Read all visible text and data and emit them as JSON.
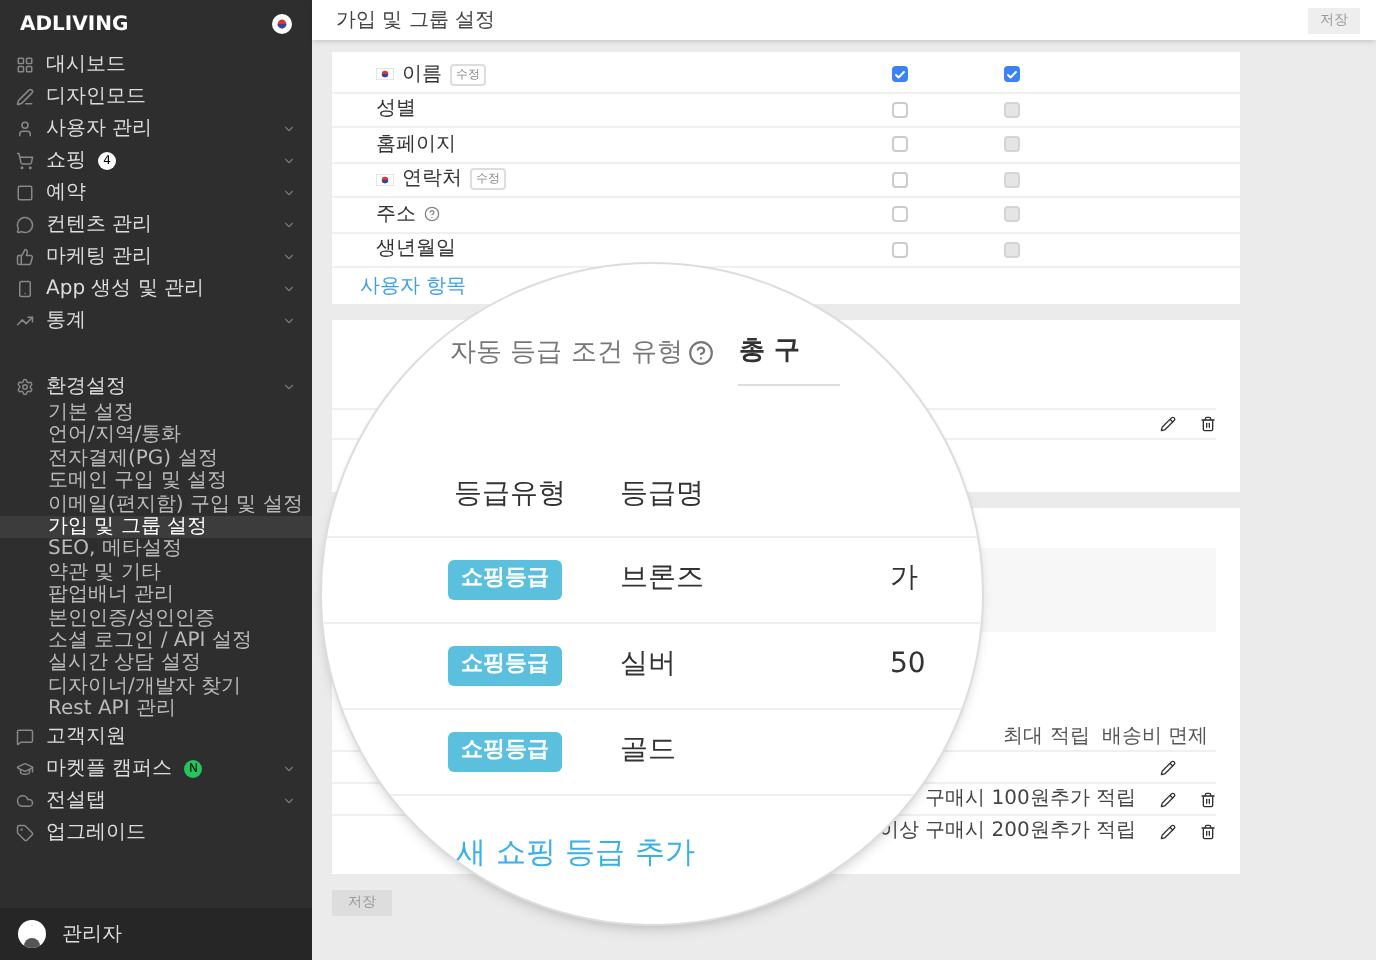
{
  "sidebar": {
    "brand": "ADLIVING",
    "items": [
      {
        "label": "대시보드",
        "expandable": false
      },
      {
        "label": "디자인모드",
        "expandable": false
      },
      {
        "label": "사용자 관리",
        "expandable": true
      },
      {
        "label": "쇼핑",
        "expandable": true,
        "badge": {
          "text": "4",
          "color": "#ffffff"
        }
      },
      {
        "label": "예약",
        "expandable": true
      },
      {
        "label": "컨텐츠 관리",
        "expandable": true
      },
      {
        "label": "마케팅 관리",
        "expandable": true
      },
      {
        "label": "App 생성 및 관리",
        "expandable": true
      },
      {
        "label": "통계",
        "expandable": true
      },
      {
        "label": "환경설정",
        "expandable": true,
        "children": [
          {
            "label": "기본 설정",
            "selected": false
          },
          {
            "label": "언어/지역/통화",
            "selected": false
          },
          {
            "label": "전자결제(PG) 설정",
            "selected": false
          },
          {
            "label": "도메인 구입 및 설정",
            "selected": false
          },
          {
            "label": "이메일(편지함) 구입 및 설정",
            "selected": false
          },
          {
            "label": "가입 및 그룹 설정",
            "selected": true
          },
          {
            "label": "SEO, 메타설정",
            "selected": false
          },
          {
            "label": "약관 및 기타",
            "selected": false
          },
          {
            "label": "팝업배너 관리",
            "selected": false
          },
          {
            "label": "본인인증/성인인증",
            "selected": false
          },
          {
            "label": "소셜 로그인 / API 설정",
            "selected": false
          },
          {
            "label": "실시간 상담 설정",
            "selected": false
          },
          {
            "label": "디자이너/개발자 찾기",
            "selected": false
          },
          {
            "label": "Rest API 관리",
            "selected": false
          }
        ]
      },
      {
        "label": "고객지원",
        "expandable": false
      },
      {
        "label": "마켓플 캠퍼스",
        "expandable": true,
        "badge": {
          "text": "N",
          "color": "#22c55e"
        }
      },
      {
        "label": "전설탭",
        "expandable": true
      },
      {
        "label": "업그레이드",
        "expandable": false
      }
    ],
    "user": {
      "name": "관리자"
    }
  },
  "header": {
    "title": "가입 및 그룹 설정",
    "save": "저장"
  },
  "fields": {
    "rows": [
      {
        "label": "이름",
        "flag": true,
        "tag": "수정",
        "info": false,
        "col1": {
          "checked": true
        },
        "col2": {
          "checked": true,
          "disabled": false
        }
      },
      {
        "label": "성별",
        "flag": false,
        "info": false,
        "col1": {
          "checked": false
        },
        "col2": {
          "checked": false,
          "disabled": true
        }
      },
      {
        "label": "홈페이지",
        "flag": false,
        "info": false,
        "col1": {
          "checked": false
        },
        "col2": {
          "checked": false,
          "disabled": true
        }
      },
      {
        "label": "연락처",
        "flag": true,
        "tag": "수정",
        "info": false,
        "col1": {
          "checked": false
        },
        "col2": {
          "checked": false,
          "disabled": true
        }
      },
      {
        "label": "주소",
        "flag": false,
        "info": true,
        "col1": {
          "checked": false
        },
        "col2": {
          "checked": false,
          "disabled": true
        }
      },
      {
        "label": "생년월일",
        "flag": false,
        "info": false,
        "col1": {
          "checked": false
        },
        "col2": {
          "checked": false,
          "disabled": true
        }
      }
    ],
    "add_link": "사용자 항목"
  },
  "benefits": {
    "columns": [
      "최대 적립",
      "배송비 면제"
    ],
    "rows": [
      {
        "deletable": false
      },
      {
        "text": "구매시 100원추가 적립",
        "deletable": true
      },
      {
        "text": "이상 구매시 200원추가 적립",
        "deletable": true
      }
    ]
  },
  "bottom_save": "저장",
  "magnifier": {
    "condition_label": "자동 등급 조건 유형",
    "condition_tab": "총 구",
    "columns": [
      "등급유형",
      "등급명"
    ],
    "rows": [
      {
        "type": "쇼핑등급",
        "name": "브론즈",
        "column_3": "가"
      },
      {
        "type": "쇼핑등급",
        "name": "실버",
        "column_3": "50"
      },
      {
        "type": "쇼핑등급",
        "name": "골드"
      }
    ],
    "add_link": "새 쇼핑 등급 추가"
  }
}
